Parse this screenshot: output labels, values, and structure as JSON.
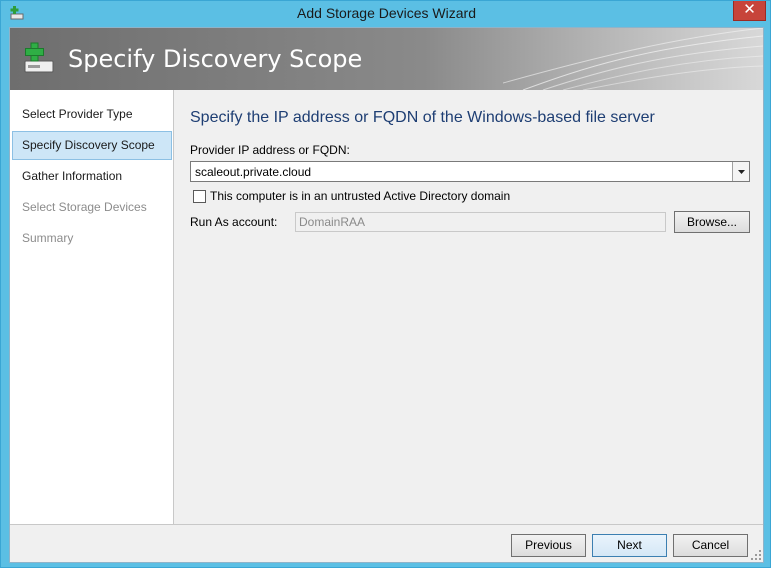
{
  "window": {
    "title": "Add Storage Devices Wizard",
    "close_label": "✕"
  },
  "banner": {
    "title": "Specify Discovery Scope"
  },
  "nav": {
    "items": [
      {
        "label": "Select Provider Type",
        "state": "completed"
      },
      {
        "label": "Specify Discovery Scope",
        "state": "selected"
      },
      {
        "label": "Gather Information",
        "state": "enabled"
      },
      {
        "label": "Select Storage Devices",
        "state": "disabled"
      },
      {
        "label": "Summary",
        "state": "disabled"
      }
    ]
  },
  "content": {
    "heading": "Specify the IP address or FQDN of the Windows-based file server",
    "provider_label": "Provider IP address or FQDN:",
    "provider_value": "scaleout.private.cloud",
    "untrusted_label": "This computer is in an untrusted Active Directory domain",
    "untrusted_checked": false,
    "runas_label": "Run As account:",
    "runas_value": "DomainRAA",
    "browse_label": "Browse..."
  },
  "footer": {
    "previous_label": "Previous",
    "next_label": "Next",
    "cancel_label": "Cancel"
  },
  "colors": {
    "frame": "#5bbfe4",
    "heading": "#1e3e73",
    "close": "#c7443a",
    "nav_selected": "#cde6f7"
  }
}
